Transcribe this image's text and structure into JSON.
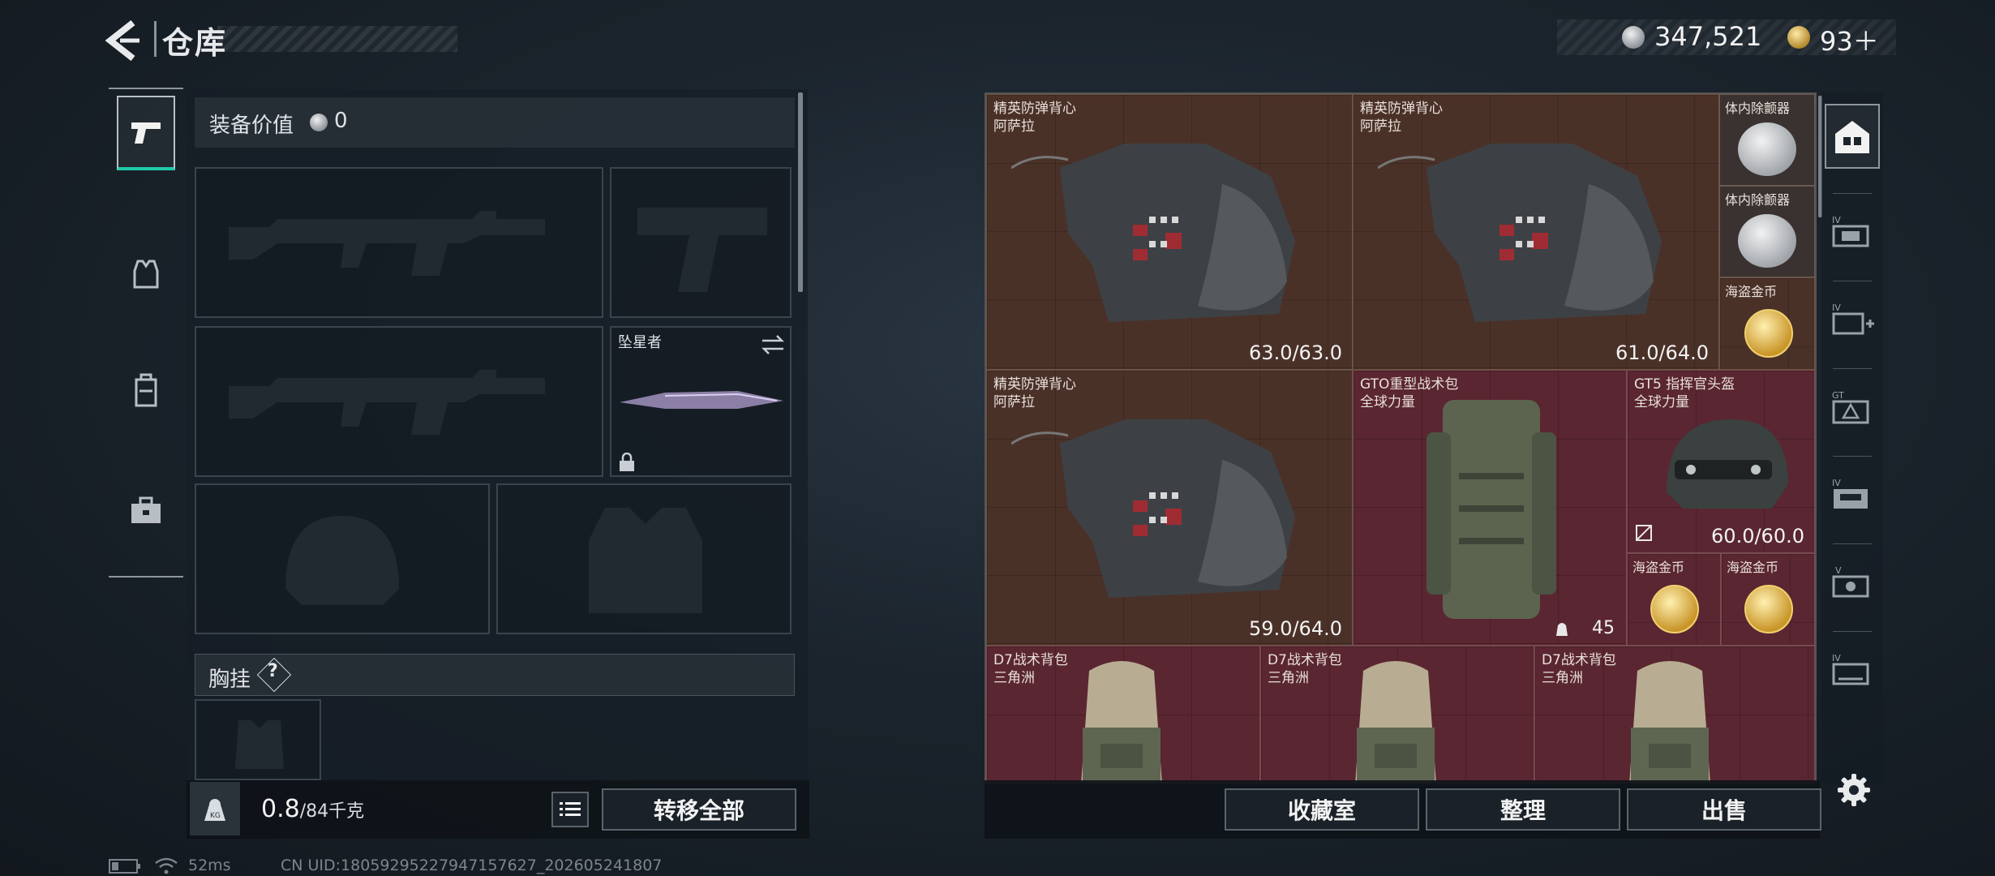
{
  "header": {
    "title": "仓库",
    "currency": [
      {
        "icon": "silver-coin-icon",
        "value": "347,521"
      },
      {
        "icon": "gold-coin-icon",
        "value": "93＋"
      }
    ]
  },
  "left_rail": {
    "items": [
      {
        "name": "weapons",
        "icon": "pistol-icon",
        "active": true
      },
      {
        "name": "armor",
        "icon": "vest-icon",
        "active": false
      },
      {
        "name": "backpack",
        "icon": "backpack-icon",
        "active": false
      },
      {
        "name": "toolbox",
        "icon": "toolbox-icon",
        "active": false
      }
    ]
  },
  "equipment": {
    "value_label": "装备价值",
    "value": "0",
    "melee_name": "坠星者",
    "chest_label": "胸挂",
    "chest_help": "?",
    "weight_value": "0.8",
    "weight_capacity": "/84千克",
    "transfer_all": "转移全部"
  },
  "storage": {
    "items": [
      {
        "id": "vest1",
        "name": "精英防弹背心",
        "brand": "阿萨拉",
        "durability": "63.0/63.0",
        "color": "brown"
      },
      {
        "id": "vest2",
        "name": "精英防弹背心",
        "brand": "阿萨拉",
        "durability": "61.0/64.0",
        "color": "brown"
      },
      {
        "id": "defib1",
        "name": "体内除颤器",
        "color": "grey"
      },
      {
        "id": "defib2",
        "name": "体内除颤器",
        "color": "grey"
      },
      {
        "id": "coin1",
        "name": "海盗金币",
        "color": "brown"
      },
      {
        "id": "vest3",
        "name": "精英防弹背心",
        "brand": "阿萨拉",
        "durability": "59.0/64.0",
        "color": "brown"
      },
      {
        "id": "bag",
        "name": "GTO重型战术包",
        "brand": "全球力量",
        "count": "45",
        "color": "red"
      },
      {
        "id": "helmet",
        "name": "GT5 指挥官头盔",
        "brand": "全球力量",
        "durability": "60.0/60.0",
        "color": "red"
      },
      {
        "id": "coin2",
        "name": "海盗金币",
        "color": "red"
      },
      {
        "id": "coin3",
        "name": "海盗金币",
        "color": "red"
      },
      {
        "id": "d7a",
        "name": "D7战术背包",
        "brand": "三角洲",
        "color": "red"
      },
      {
        "id": "d7b",
        "name": "D7战术背包",
        "brand": "三角洲",
        "color": "red"
      },
      {
        "id": "d7c",
        "name": "D7战术背包",
        "brand": "三角洲",
        "color": "red"
      }
    ],
    "buttons": {
      "collection": "收藏室",
      "organize": "整理",
      "sell": "出售"
    }
  },
  "right_rail": {
    "items": [
      {
        "icon": "storage-home-icon",
        "label": ""
      },
      {
        "icon": "warehouse-iv-icon",
        "label": "IV"
      },
      {
        "icon": "warehouse-iv-add-icon",
        "label": "IV"
      },
      {
        "icon": "warehouse-gt-icon",
        "label": "GT"
      },
      {
        "icon": "warehouse-iv-2-icon",
        "label": "IV"
      },
      {
        "icon": "warehouse-v-icon",
        "label": "V"
      },
      {
        "icon": "warehouse-iv-3-icon",
        "label": "IV"
      }
    ],
    "settings_icon": "gear-icon"
  },
  "status_bar": {
    "ping": "52ms",
    "uid": "CN UID:18059295227947157627_202605241807"
  }
}
